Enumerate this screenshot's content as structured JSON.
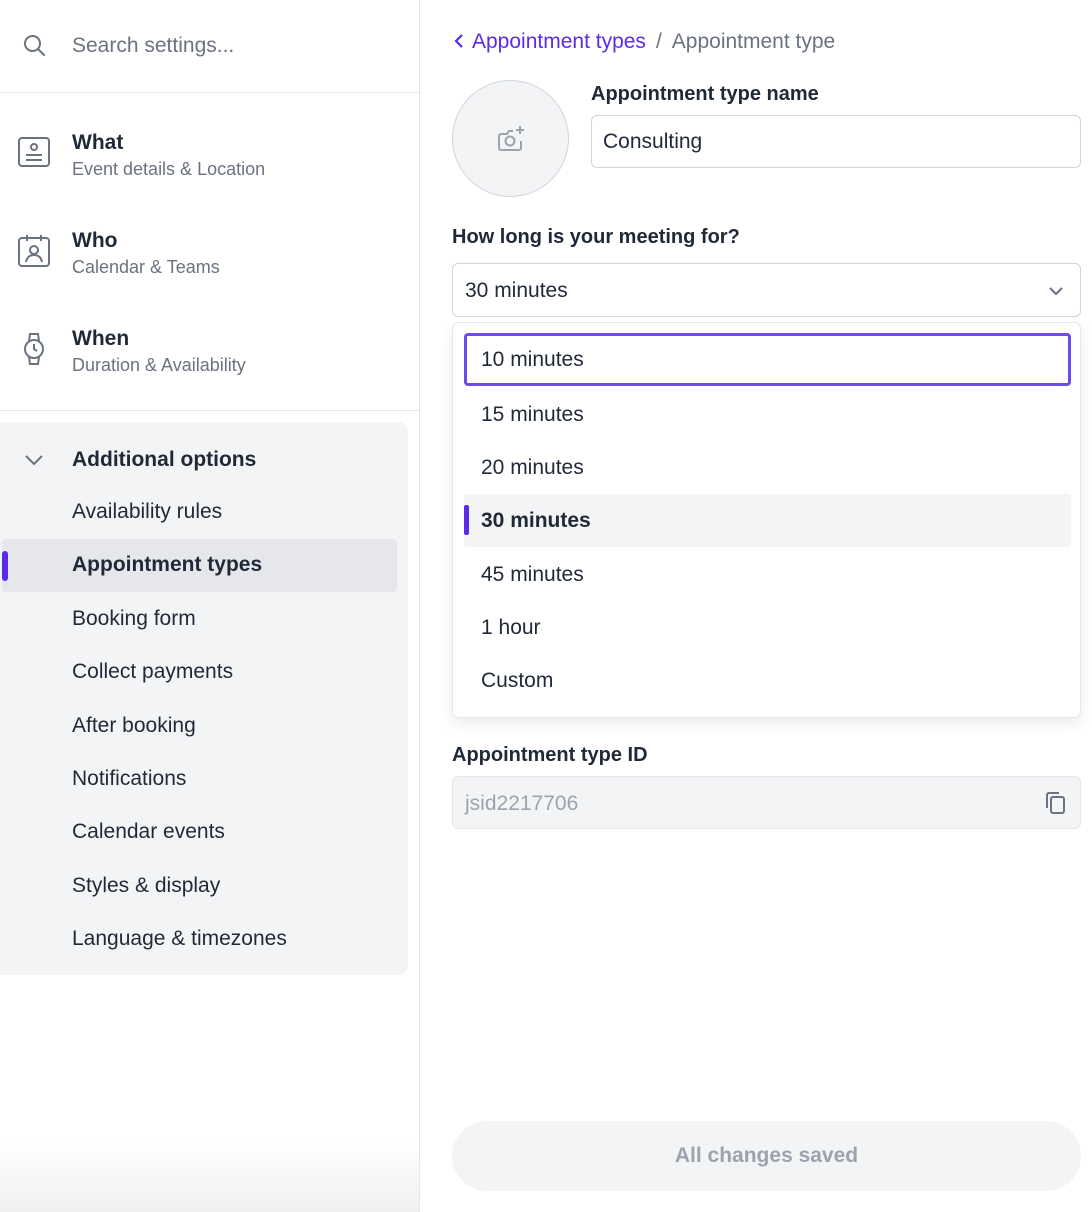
{
  "search": {
    "placeholder": "Search settings..."
  },
  "nav": {
    "what": {
      "title": "What",
      "subtitle": "Event details & Location"
    },
    "who": {
      "title": "Who",
      "subtitle": "Calendar & Teams"
    },
    "when": {
      "title": "When",
      "subtitle": "Duration & Availability"
    }
  },
  "additional": {
    "title": "Additional options",
    "items": [
      {
        "label": "Availability rules"
      },
      {
        "label": "Appointment types",
        "active": true
      },
      {
        "label": "Booking form"
      },
      {
        "label": "Collect payments"
      },
      {
        "label": "After booking"
      },
      {
        "label": "Notifications"
      },
      {
        "label": "Calendar events"
      },
      {
        "label": "Styles & display"
      },
      {
        "label": "Language & timezones"
      }
    ]
  },
  "breadcrumb": {
    "back": "Appointment types",
    "separator": "/",
    "current": "Appointment type"
  },
  "name_field": {
    "label": "Appointment type name",
    "value": "Consulting"
  },
  "duration": {
    "label": "How long is your meeting for?",
    "selected": "30 minutes",
    "options": [
      "10 minutes",
      "15 minutes",
      "20 minutes",
      "30 minutes",
      "45 minutes",
      "1 hour",
      "Custom"
    ],
    "focused_index": 0,
    "selected_index": 3
  },
  "id_field": {
    "label": "Appointment type ID",
    "value": "jsid2217706"
  },
  "save": {
    "label": "All changes saved"
  },
  "colors": {
    "accent": "#5b2be8",
    "focus_ring": "#6d4aec",
    "muted": "#6b7280"
  }
}
